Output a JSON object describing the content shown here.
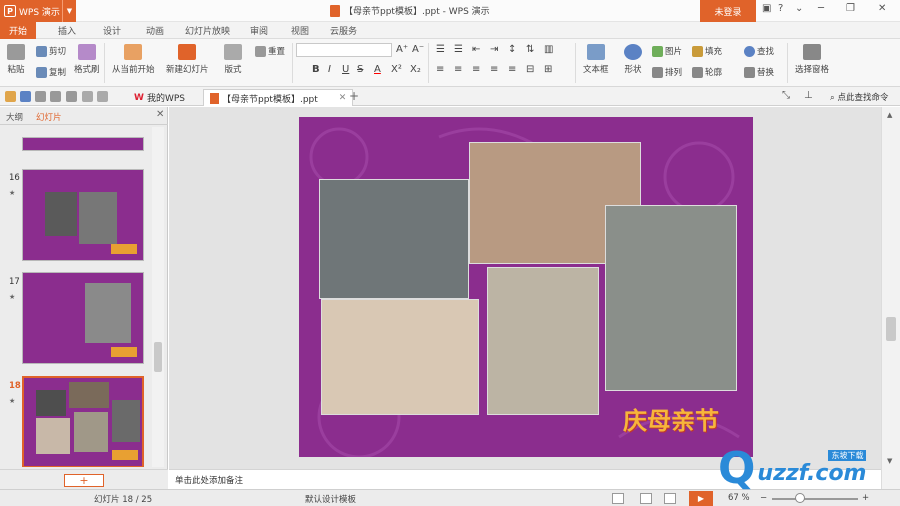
{
  "app": {
    "name": "WPS 演示",
    "window_title": "【母亲节ppt模板】.ppt - WPS 演示",
    "login_label": "未登录",
    "accent": "#e0632a",
    "slide_bg": "#8b2d8e"
  },
  "ribbon_tabs": [
    "开始",
    "插入",
    "设计",
    "动画",
    "幻灯片放映",
    "审阅",
    "视图",
    "云服务"
  ],
  "ribbon": {
    "paste": "粘贴",
    "cut": "剪切",
    "copy": "复制",
    "format_painter": "格式刷",
    "from_current": "从当前开始",
    "new_slide": "新建幻灯片",
    "layout": "版式",
    "reset": "重置",
    "text_box": "文本框",
    "shape": "形状",
    "image": "图片",
    "arrange": "排列",
    "fill": "填充",
    "outline": "轮廓",
    "find": "查找",
    "replace": "替换",
    "select_pane": "选择窗格"
  },
  "format_buttons": [
    "B",
    "I",
    "U",
    "S",
    "A",
    "X²",
    "X₂"
  ],
  "doc_tabs": [
    {
      "label": "我的WPS"
    },
    {
      "label": "【母亲节ppt模板】.ppt"
    }
  ],
  "search_cmd": "点此查找命令",
  "left_panel": {
    "tabs": [
      "大纲",
      "幻灯片"
    ]
  },
  "slides": [
    {
      "num": "16"
    },
    {
      "num": "17"
    },
    {
      "num": "18"
    }
  ],
  "notes_placeholder": "单击此处添加备注",
  "status": {
    "slide_counter": "幻灯片 18 / 25",
    "template": "默认设计模板",
    "zoom": "67 %"
  },
  "slide_logo_text": "庆母亲节",
  "watermark": "uzzf.com",
  "watermark_sub": "东坡下载"
}
